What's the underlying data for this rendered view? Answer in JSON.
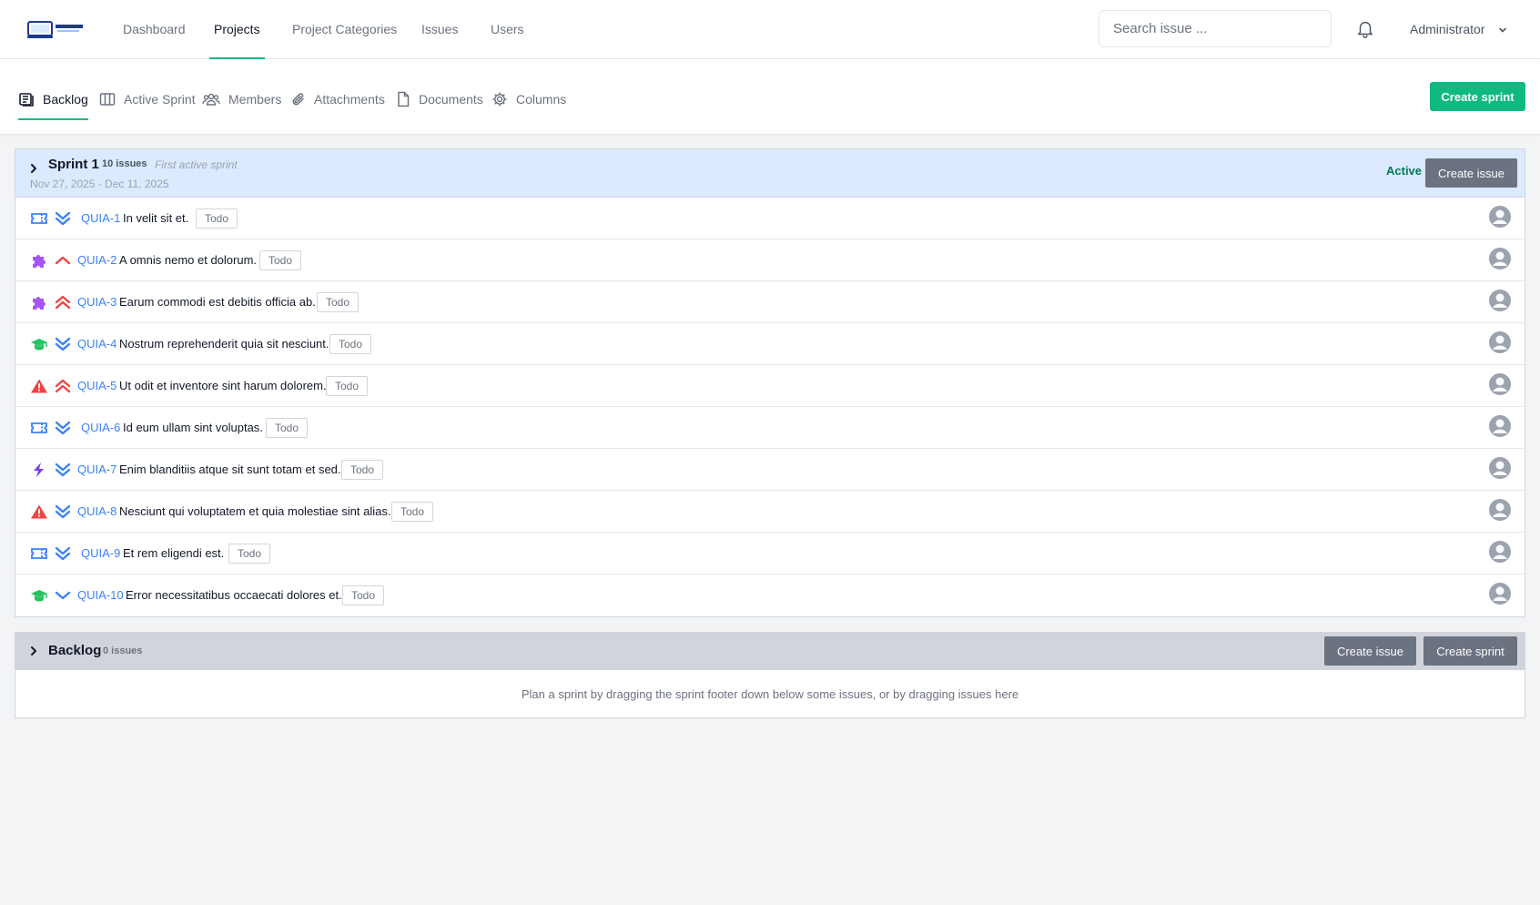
{
  "nav": {
    "items": [
      {
        "label": "Dashboard",
        "active": false
      },
      {
        "label": "Projects",
        "active": true
      },
      {
        "label": "Project Categories",
        "active": false
      },
      {
        "label": "Issues",
        "active": false
      },
      {
        "label": "Users",
        "active": false
      }
    ],
    "search_placeholder": "Search issue ...",
    "user": "Administrator"
  },
  "tabs": [
    {
      "label": "Backlog",
      "icon": "backlog-icon",
      "active": true
    },
    {
      "label": "Active Sprint",
      "icon": "columns-board-icon",
      "active": false
    },
    {
      "label": "Members",
      "icon": "users-icon",
      "active": false
    },
    {
      "label": "Attachments",
      "icon": "paperclip-icon",
      "active": false
    },
    {
      "label": "Documents",
      "icon": "document-icon",
      "active": false
    },
    {
      "label": "Columns",
      "icon": "gear-icon",
      "active": false
    }
  ],
  "create_sprint_label": "Create sprint",
  "sprint": {
    "name": "Sprint 1",
    "count": "10 issues",
    "goal": "First active sprint",
    "dates": "Nov 27, 2025 - Dec 11, 2025",
    "status": "Active",
    "create_issue_label": "Create issue",
    "issues": [
      {
        "key": "QUIA-1",
        "title": "In velit sit et.",
        "status": "Todo",
        "type": "ticket",
        "priority": "lowest"
      },
      {
        "key": "QUIA-2",
        "title": "A omnis nemo et dolorum.",
        "status": "Todo",
        "type": "puzzle",
        "priority": "high"
      },
      {
        "key": "QUIA-3",
        "title": "Earum commodi est debitis officia ab.",
        "status": "Todo",
        "type": "puzzle",
        "priority": "highest"
      },
      {
        "key": "QUIA-4",
        "title": "Nostrum reprehenderit quia sit nesciunt.",
        "status": "Todo",
        "type": "graduation",
        "priority": "lowest"
      },
      {
        "key": "QUIA-5",
        "title": "Ut odit et inventore sint harum dolorem.",
        "status": "Todo",
        "type": "warning",
        "priority": "highest"
      },
      {
        "key": "QUIA-6",
        "title": "Id eum ullam sint voluptas.",
        "status": "Todo",
        "type": "ticket",
        "priority": "lowest"
      },
      {
        "key": "QUIA-7",
        "title": "Enim blanditiis atque sit sunt totam et sed.",
        "status": "Todo",
        "type": "bolt",
        "priority": "lowest"
      },
      {
        "key": "QUIA-8",
        "title": "Nesciunt qui voluptatem et quia molestiae sint alias.",
        "status": "Todo",
        "type": "warning",
        "priority": "lowest"
      },
      {
        "key": "QUIA-9",
        "title": "Et rem eligendi est.",
        "status": "Todo",
        "type": "ticket",
        "priority": "lowest"
      },
      {
        "key": "QUIA-10",
        "title": "Error necessitatibus occaecati dolores et.",
        "status": "Todo",
        "type": "graduation",
        "priority": "low"
      }
    ]
  },
  "backlog": {
    "name": "Backlog",
    "count": "0 issues",
    "create_issue_label": "Create issue",
    "create_sprint_label": "Create sprint",
    "hint": "Plan a sprint by dragging the sprint footer down below some issues, or by dragging issues here"
  },
  "colors": {
    "accent": "#10b981",
    "link": "#3b82f6",
    "sprint_header": "#dbeafe",
    "backlog_header": "#d1d5db",
    "button_gray": "#6b7280",
    "active_text": "#047857",
    "priority_high": "#ef4444",
    "priority_low": "#3b82f6"
  }
}
